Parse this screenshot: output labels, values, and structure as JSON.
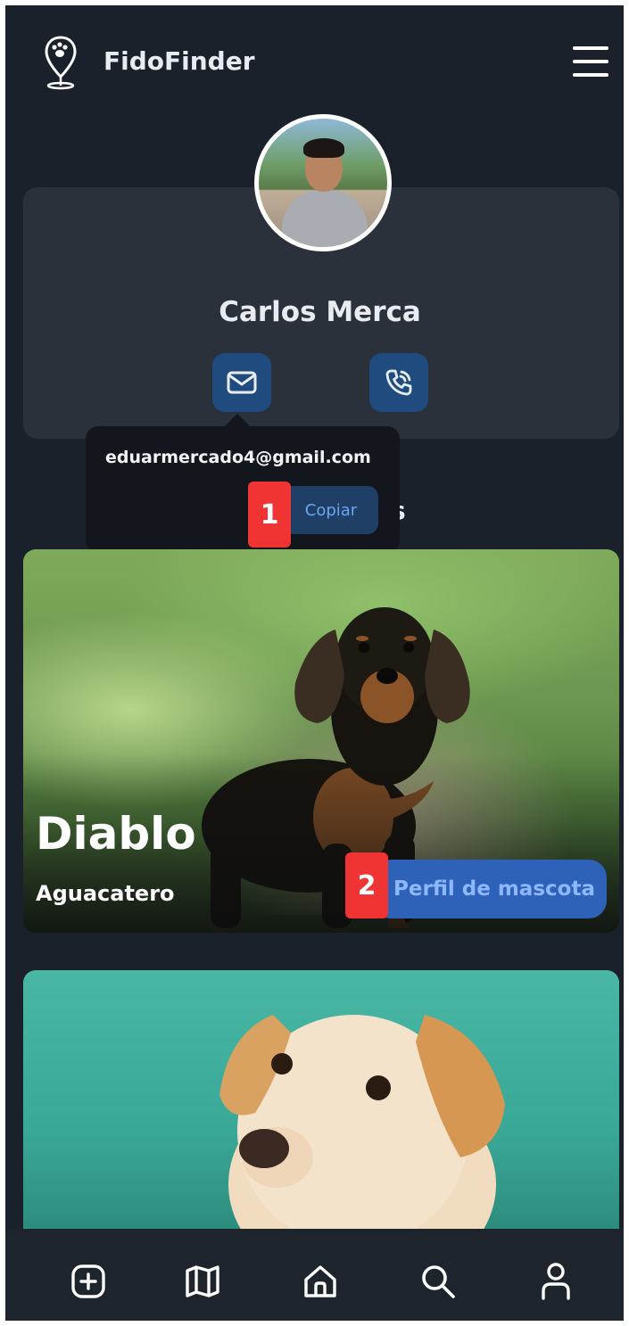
{
  "header": {
    "app_title": "FidoFinder"
  },
  "profile": {
    "name": "Carlos Merca"
  },
  "email_popover": {
    "email": "eduarmercado4@gmail.com",
    "copy_label": "Copiar"
  },
  "section": {
    "partial_heading": "s"
  },
  "markers": [
    "1",
    "2"
  ],
  "pets": [
    {
      "name": "Diablo",
      "subtitle": "Aguacatero",
      "button_label": "Perfil de mascota"
    }
  ],
  "bottom_nav": {
    "items": [
      "add-icon",
      "map-icon",
      "home-icon",
      "search-icon",
      "user-icon"
    ]
  },
  "colors": {
    "background": "#1b212a",
    "card": "#2b313b",
    "accent_blue": "#1f4b7e",
    "button_blue": "#2e62b8",
    "marker_red": "#f03434"
  }
}
